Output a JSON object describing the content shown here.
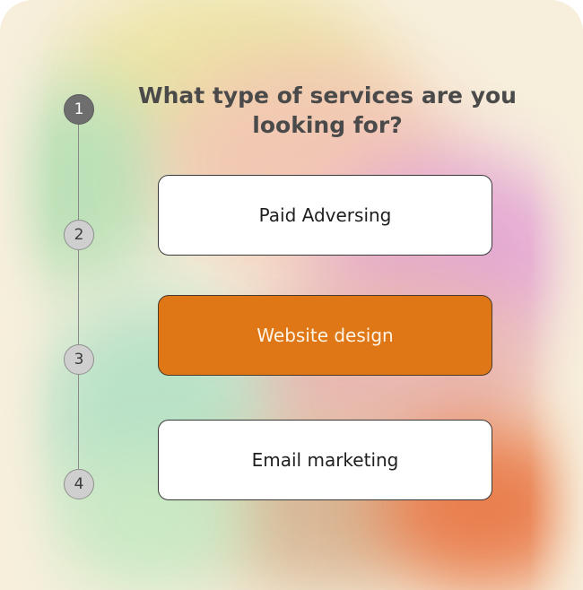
{
  "question": {
    "title": "What type of services are you looking for?"
  },
  "steps": [
    {
      "label": "1",
      "state": "active"
    },
    {
      "label": "2",
      "state": "inactive"
    },
    {
      "label": "3",
      "state": "inactive"
    },
    {
      "label": "4",
      "state": "inactive"
    }
  ],
  "options": [
    {
      "label": "Paid Adversing",
      "selected": false
    },
    {
      "label": "Website design",
      "selected": true
    },
    {
      "label": "Email marketing",
      "selected": false
    }
  ],
  "colors": {
    "selected_option": "#df7717",
    "active_step": "#6e6e6e",
    "inactive_step": "#cfcfcf",
    "background": "#f7efdc"
  }
}
